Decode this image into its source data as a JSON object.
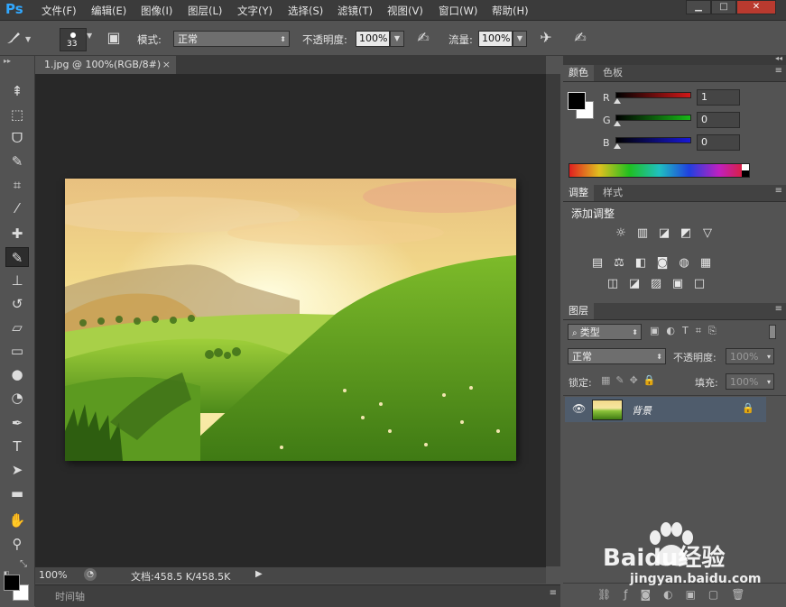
{
  "app": {
    "logo": "Ps"
  },
  "menu": [
    "文件(F)",
    "编辑(E)",
    "图像(I)",
    "图层(L)",
    "文字(Y)",
    "选择(S)",
    "滤镜(T)",
    "视图(V)",
    "窗口(W)",
    "帮助(H)"
  ],
  "window_controls": {
    "minimize": "▁",
    "maximize": "□",
    "close": "✕"
  },
  "options": {
    "brush_size": "33",
    "mode_label": "模式:",
    "mode_value": "正常",
    "opacity_label": "不透明度:",
    "opacity_value": "100%",
    "flow_label": "流量:",
    "flow_value": "100%"
  },
  "tools": [
    {
      "name": "move-tool",
      "glyph": "⇞"
    },
    {
      "name": "marquee-tool",
      "glyph": "⬚"
    },
    {
      "name": "lasso-tool",
      "glyph": "ᗜ"
    },
    {
      "name": "quick-select-tool",
      "glyph": "✎"
    },
    {
      "name": "crop-tool",
      "glyph": "⌗"
    },
    {
      "name": "eyedropper-tool",
      "glyph": "⁄"
    },
    {
      "name": "healing-brush-tool",
      "glyph": "✚"
    },
    {
      "name": "brush-tool",
      "glyph": "✎"
    },
    {
      "name": "clone-stamp-tool",
      "glyph": "⊥"
    },
    {
      "name": "history-brush-tool",
      "glyph": "↺"
    },
    {
      "name": "eraser-tool",
      "glyph": "▱"
    },
    {
      "name": "gradient-tool",
      "glyph": "▭"
    },
    {
      "name": "blur-tool",
      "glyph": "●"
    },
    {
      "name": "dodge-tool",
      "glyph": "◔"
    },
    {
      "name": "pen-tool",
      "glyph": "✒"
    },
    {
      "name": "type-tool",
      "glyph": "T"
    },
    {
      "name": "path-select-tool",
      "glyph": "➤"
    },
    {
      "name": "rectangle-tool",
      "glyph": "▬"
    },
    {
      "name": "hand-tool",
      "glyph": "✋"
    },
    {
      "name": "zoom-tool",
      "glyph": "⚲"
    }
  ],
  "document": {
    "tab_title": "1.jpg @ 100%(RGB/8#)",
    "tab_close": "×",
    "zoom": "100%",
    "doc_info": "文档:458.5 K/458.5K",
    "timeline_label": "时间轴"
  },
  "color_panel": {
    "tabs": [
      "颜色",
      "色板"
    ],
    "channels": [
      {
        "label": "R",
        "value": "1",
        "color": "#d01818"
      },
      {
        "label": "G",
        "value": "0",
        "color": "#18b818"
      },
      {
        "label": "B",
        "value": "0",
        "color": "#1818d8"
      }
    ],
    "foreground": "#000000",
    "background": "#ffffff"
  },
  "adjustments_panel": {
    "tabs": [
      "调整",
      "样式"
    ],
    "heading": "添加调整",
    "row1": [
      "☼",
      "▥",
      "◪",
      "◩",
      "▽"
    ],
    "row2": [
      "▤",
      "⚖",
      "◧",
      "◙",
      "◍",
      "▦"
    ],
    "row3": [
      "◫",
      "◪",
      "▨",
      "▣",
      "□"
    ]
  },
  "layers_panel": {
    "tab": "图层",
    "filter_label": "类型",
    "blend_mode": "正常",
    "opacity_label": "不透明度:",
    "opacity_value": "100%",
    "lock_label": "锁定:",
    "fill_label": "填充:",
    "fill_value": "100%",
    "layer_name": "背景"
  },
  "watermark": {
    "brand": "Baidu经验",
    "url": "jingyan.baidu.com"
  }
}
